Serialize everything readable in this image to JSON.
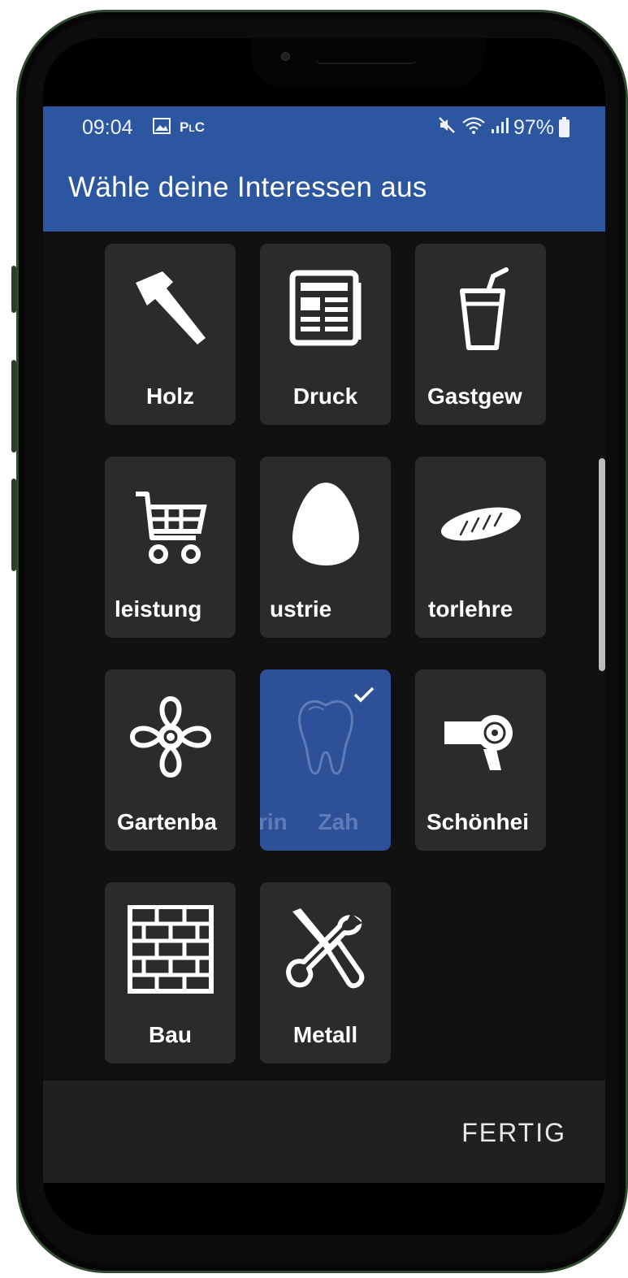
{
  "status_bar": {
    "time": "09:04",
    "battery": "97%",
    "icons": [
      "image-icon",
      "pc-icon",
      "mute-icon",
      "wifi-icon",
      "signal-icon",
      "battery-icon"
    ]
  },
  "app_bar": {
    "title": "Wähle deine Interessen aus"
  },
  "tiles": [
    {
      "label": "Holz",
      "icon": "hammer-icon",
      "selected": false
    },
    {
      "label": "Druck",
      "icon": "newspaper-icon",
      "selected": false
    },
    {
      "label": "Gastgew",
      "icon": "drink-icon",
      "selected": false
    },
    {
      "label": "leistung",
      "icon": "cart-icon",
      "selected": false
    },
    {
      "label": "ustrie",
      "icon": "egg-icon",
      "selected": false
    },
    {
      "label": "torlehre",
      "icon": "bread-icon",
      "selected": false
    },
    {
      "label": "Gartenba",
      "icon": "flower-icon",
      "selected": false
    },
    {
      "label": "rin Zah",
      "icon": "tooth-icon",
      "selected": true
    },
    {
      "label": "Schönhei",
      "icon": "hairdryer-icon",
      "selected": false
    },
    {
      "label": "Bau",
      "icon": "brick-wall-icon",
      "selected": false
    },
    {
      "label": "Metall",
      "icon": "tools-icon",
      "selected": false
    }
  ],
  "footer": {
    "done_label": "FERTIG"
  },
  "colors": {
    "primary": "#2d56a0",
    "tile_background": "#2b2b2b",
    "selected_tile": "#2d5099",
    "content_background": "#111111"
  }
}
